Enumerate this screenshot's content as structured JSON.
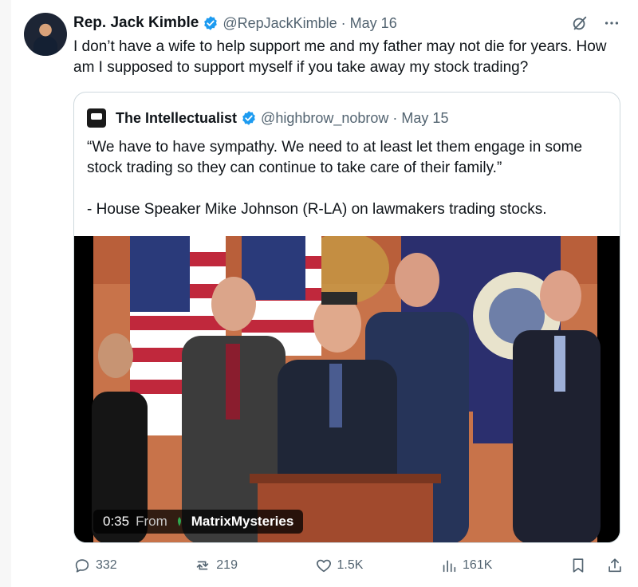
{
  "tweet": {
    "author_name": "Rep. Jack Kimble",
    "handle": "@RepJackKimble",
    "separator": "·",
    "date": "May 16",
    "text": "I don’t have a wife to help support me and my father may not die for years. How am I supposed to support myself if you take away my stock trading?"
  },
  "quote": {
    "author_name": "The Intellectualist",
    "handle": "@highbrow_nobrow",
    "separator": "·",
    "date": "May 15",
    "text_line1": "“We have to have sympathy. We need to at least let them engage in some stock trading so they can continue to take care of their family.”",
    "text_line2": "- House Speaker Mike Johnson (R-LA) on lawmakers trading stocks."
  },
  "video": {
    "duration": "0:35",
    "from_label": "From",
    "source_name": "MatrixMysteries"
  },
  "actions": {
    "replies": "332",
    "reposts": "219",
    "likes": "1.5K",
    "views": "161K"
  },
  "colors": {
    "verified": "#1d9bf0",
    "muted_text": "#536471",
    "border": "#cfd9de"
  },
  "icons": {
    "more": "more-icon",
    "grok": "grok-icon",
    "reply": "reply-icon",
    "repost": "repost-icon",
    "like": "like-icon",
    "views": "views-icon",
    "bookmark": "bookmark-icon",
    "share": "share-icon"
  }
}
